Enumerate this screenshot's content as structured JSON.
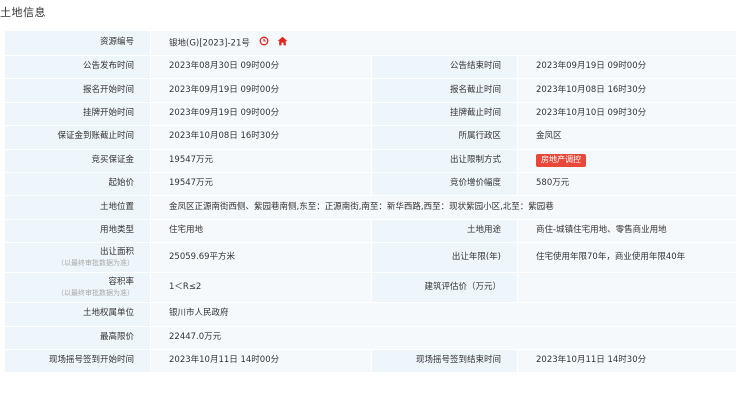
{
  "page_title": "土地信息",
  "colors": {
    "label_bg": "#eef5fb",
    "value_bg": "#f6f9fc",
    "badge_bg": "#e8473a",
    "icon_red": "#e0261e"
  },
  "icons": [
    "clock-icon",
    "home-icon"
  ],
  "rows": {
    "resource_no": {
      "label": "资源编号",
      "value": "银地(G)[2023]-21号"
    },
    "announce_start": {
      "label": "公告发布时间",
      "value": "2023年08月30日 09时00分"
    },
    "announce_end": {
      "label": "公告结束时间",
      "value": "2023年09月19日 09时00分"
    },
    "signup_start": {
      "label": "报名开始时间",
      "value": "2023年09月19日 09时00分"
    },
    "signup_end": {
      "label": "报名截止时间",
      "value": "2023年10月08日 16时30分"
    },
    "listing_start": {
      "label": "挂牌开始时间",
      "value": "2023年09月19日 09时00分"
    },
    "listing_end": {
      "label": "挂牌截止时间",
      "value": "2023年10月10日 09时30分"
    },
    "deposit_deadline": {
      "label": "保证金到账截止时间",
      "value": "2023年10月08日 16时30分"
    },
    "district": {
      "label": "所属行政区",
      "value": "金凤区"
    },
    "bid_deposit": {
      "label": "竞买保证金",
      "value": "19547万元"
    },
    "restriction": {
      "label": "出让限制方式",
      "value": "房地产调控"
    },
    "start_price": {
      "label": "起始价",
      "value": "19547万元"
    },
    "bid_increment": {
      "label": "竞价增价幅度",
      "value": "580万元"
    },
    "location": {
      "label": "土地位置",
      "value": "金凤区正源南街西侧、紫园巷南侧,东至：正源南街,南至：新华西路,西至：现状紫园小区,北至：紫园巷"
    },
    "land_type": {
      "label": "用地类型",
      "value": "住宅用地"
    },
    "land_use": {
      "label": "土地用途",
      "value": "商住-城镇住宅用地、零售商业用地"
    },
    "area": {
      "label": "出让面积",
      "sub": "（以最终审批数据为准）",
      "value": "25059.69平方米"
    },
    "term": {
      "label": "出让年限(年)",
      "value": "住宅使用年限70年，商业使用年限40年"
    },
    "far": {
      "label": "容积率",
      "sub": "（以最终审批数据为准）",
      "value": "1＜R≤2"
    },
    "appraisal": {
      "label": "建筑评估价（万元）",
      "value": ""
    },
    "owner": {
      "label": "土地权属单位",
      "value": "银川市人民政府"
    },
    "max_price": {
      "label": "最高限价",
      "value": "22447.0万元"
    },
    "lottery_signin_start": {
      "label": "现场摇号签到开始时间",
      "value": "2023年10月11日 14时00分"
    },
    "lottery_signin_end": {
      "label": "现场摇号签到结束时间",
      "value": "2023年10月11日 14时30分"
    }
  }
}
